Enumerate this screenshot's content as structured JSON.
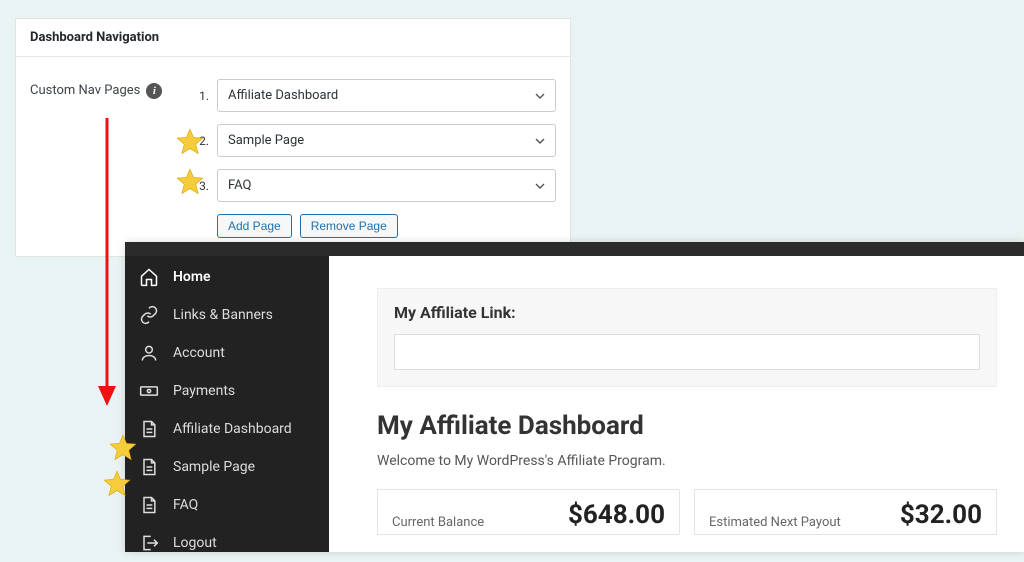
{
  "settings": {
    "card_title": "Dashboard Navigation",
    "label": "Custom Nav Pages",
    "pages": [
      {
        "num": "1.",
        "value": "Affiliate Dashboard"
      },
      {
        "num": "2.",
        "value": "Sample Page"
      },
      {
        "num": "3.",
        "value": "FAQ"
      }
    ],
    "add_btn": "Add Page",
    "remove_btn": "Remove Page"
  },
  "dashboard": {
    "sidebar": [
      {
        "label": "Home",
        "icon": "home"
      },
      {
        "label": "Links & Banners",
        "icon": "link"
      },
      {
        "label": "Account",
        "icon": "user"
      },
      {
        "label": "Payments",
        "icon": "cash"
      },
      {
        "label": "Affiliate Dashboard",
        "icon": "doc"
      },
      {
        "label": "Sample Page",
        "icon": "doc"
      },
      {
        "label": "FAQ",
        "icon": "doc"
      },
      {
        "label": "Logout",
        "icon": "logout"
      }
    ],
    "link_title": "My Affiliate Link:",
    "heading": "My Affiliate Dashboard",
    "subtext": "Welcome to My WordPress's Affiliate Program.",
    "stat1_label": "Current Balance",
    "stat1_value": "$648.00",
    "stat2_label": "Estimated Next Payout",
    "stat2_value": "$32.00"
  }
}
